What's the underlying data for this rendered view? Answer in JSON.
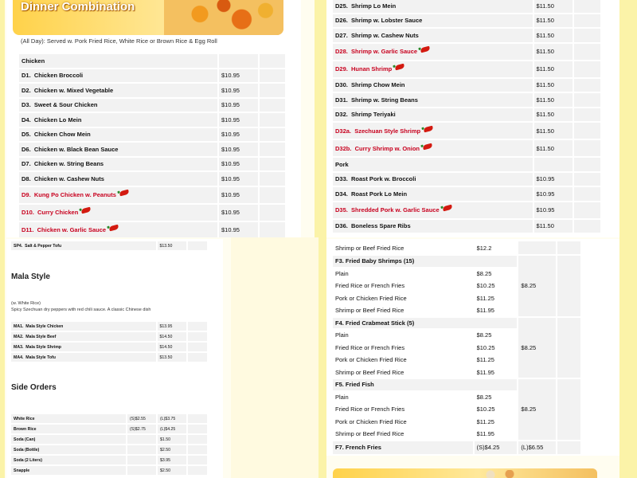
{
  "panelA": {
    "title": "Dinner Combination",
    "note": "(All Day): Served w. Pork Fried Rice, White Rice or Brown Rice & Egg Roll",
    "section": "Chicken",
    "items": [
      {
        "code": "D1.",
        "name": "Chicken Broccoli",
        "price": "$10.95",
        "spicy": false
      },
      {
        "code": "D2.",
        "name": "Chicken w. Mixed Vegetable",
        "price": "$10.95",
        "spicy": false
      },
      {
        "code": "D3.",
        "name": "Sweet & Sour Chicken",
        "price": "$10.95",
        "spicy": false
      },
      {
        "code": "D4.",
        "name": "Chicken Lo Mein",
        "price": "$10.95",
        "spicy": false
      },
      {
        "code": "D5.",
        "name": "Chicken Chow Mein",
        "price": "$10.95",
        "spicy": false
      },
      {
        "code": "D6.",
        "name": "Chicken w. Black Bean Sauce",
        "price": "$10.95",
        "spicy": false
      },
      {
        "code": "D7.",
        "name": "Chicken w. String Beans",
        "price": "$10.95",
        "spicy": false
      },
      {
        "code": "D8.",
        "name": "Chicken w. Cashew Nuts",
        "price": "$10.95",
        "spicy": false
      },
      {
        "code": "D9.",
        "name": "Kung Po Chicken w. Peanuts",
        "price": "$10.95",
        "spicy": true
      },
      {
        "code": "D10.",
        "name": "Curry Chicken",
        "price": "$10.95",
        "spicy": true
      },
      {
        "code": "D11.",
        "name": "Chicken w. Garlic Sauce",
        "price": "$10.95",
        "spicy": true
      }
    ]
  },
  "panelB": {
    "items": [
      {
        "code": "D25.",
        "name": "Shrimp Lo Mein",
        "price": "$11.50",
        "spicy": false
      },
      {
        "code": "D26.",
        "name": "Shrimp w. Lobster Sauce",
        "price": "$11.50",
        "spicy": false
      },
      {
        "code": "D27.",
        "name": "Shrimp w. Cashew Nuts",
        "price": "$11.50",
        "spicy": false
      },
      {
        "code": "D28.",
        "name": "Shrimp w. Garlic Sauce",
        "price": "$11.50",
        "spicy": true
      },
      {
        "code": "D29.",
        "name": "Hunan Shrimp",
        "price": "$11.50",
        "spicy": true
      },
      {
        "code": "D30.",
        "name": "Shrimp Chow Mein",
        "price": "$11.50",
        "spicy": false
      },
      {
        "code": "D31.",
        "name": "Shrimp w. String Beans",
        "price": "$11.50",
        "spicy": false
      },
      {
        "code": "D32.",
        "name": "Shrimp Teriyaki",
        "price": "$11.50",
        "spicy": false
      },
      {
        "code": "D32a.",
        "name": "Szechuan Style Shrimp",
        "price": "$11.50",
        "spicy": true
      },
      {
        "code": "D32b.",
        "name": "Curry Shrimp w. Onion",
        "price": "$11.50",
        "spicy": true
      }
    ],
    "section": "Pork",
    "pork": [
      {
        "code": "D33.",
        "name": "Roast Pork w. Broccoli",
        "price": "$10.95",
        "spicy": false
      },
      {
        "code": "D34.",
        "name": "Roast Pork Lo Mein",
        "price": "$10.95",
        "spicy": false
      },
      {
        "code": "D35.",
        "name": "Shredded Pork w. Garlic Sauce",
        "price": "$10.95",
        "spicy": true
      },
      {
        "code": "D36.",
        "name": "Boneless Spare Ribs",
        "price": "$11.50",
        "spicy": false
      }
    ]
  },
  "panelC": {
    "top": {
      "code": "SP4.",
      "name": "Salt & Pepper Tofu",
      "price": "$13.50"
    },
    "mala_title": "Mala Style",
    "mala_note1": "(w. White Rice)",
    "mala_note2": "Spicy Szechuan dry peppers with red chili sauce. A classic Chinese dish",
    "mala": [
      {
        "code": "MA1.",
        "name": "Mala Style Chicken",
        "price": "$13.95"
      },
      {
        "code": "MA2.",
        "name": "Mala Style Beef",
        "price": "$14.50"
      },
      {
        "code": "MA3.",
        "name": "Mala Style Shrimp",
        "price": "$14.50"
      },
      {
        "code": "MA4.",
        "name": "Mala Style Tofu",
        "price": "$13.50"
      }
    ],
    "side_title": "Side Orders",
    "sides": [
      {
        "name": "White Rice",
        "small": "(S)$2.55",
        "large": "(L)$3.75"
      },
      {
        "name": "Brown Rice",
        "small": "(S)$2.75",
        "large": "(L)$4.25"
      },
      {
        "name": "Soda (Can)",
        "small": "",
        "large": "$1.50"
      },
      {
        "name": "Soda (Bottle)",
        "small": "",
        "large": "$2.50"
      },
      {
        "name": "Soda (2 Liters)",
        "small": "",
        "large": "$3.95"
      },
      {
        "name": "Snapple",
        "small": "",
        "large": "$2.50"
      }
    ]
  },
  "panelD": {
    "top": {
      "name": "Shrimp or Beef Fried Rice",
      "price": "$12.2"
    },
    "groups": [
      {
        "title": "F3.  Fried Baby Shrimps (15)",
        "base": "$8.25",
        "rows": [
          {
            "name": "Plain",
            "price": "$8.25"
          },
          {
            "name": "Fried Rice or French Fries",
            "price": "$10.25"
          },
          {
            "name": "Pork or Chicken Fried Rice",
            "price": "$11.25"
          },
          {
            "name": "Shrimp or Beef Fried Rice",
            "price": "$11.95"
          }
        ]
      },
      {
        "title": "F4.  Fried Crabmeat Stick (5)",
        "base": "$8.25",
        "rows": [
          {
            "name": "Plain",
            "price": "$8.25"
          },
          {
            "name": "Fried Rice or French Fries",
            "price": "$10.25"
          },
          {
            "name": "Pork or Chicken Fried Rice",
            "price": "$11.25"
          },
          {
            "name": "Shrimp or Beef Fried Rice",
            "price": "$11.95"
          }
        ]
      },
      {
        "title": "F5.  Fried Fish",
        "base": "$8.25",
        "rows": [
          {
            "name": "Plain",
            "price": "$8.25"
          },
          {
            "name": "Fried Rice or French Fries",
            "price": "$10.25"
          },
          {
            "name": "Pork or Chicken Fried Rice",
            "price": "$11.25"
          },
          {
            "name": "Shrimp or Beef Fried Rice",
            "price": "$11.95"
          }
        ]
      }
    ],
    "fries": {
      "title": "F7.  French Fries",
      "small": "(S)$4.25",
      "large": "(L)$6.55"
    }
  }
}
